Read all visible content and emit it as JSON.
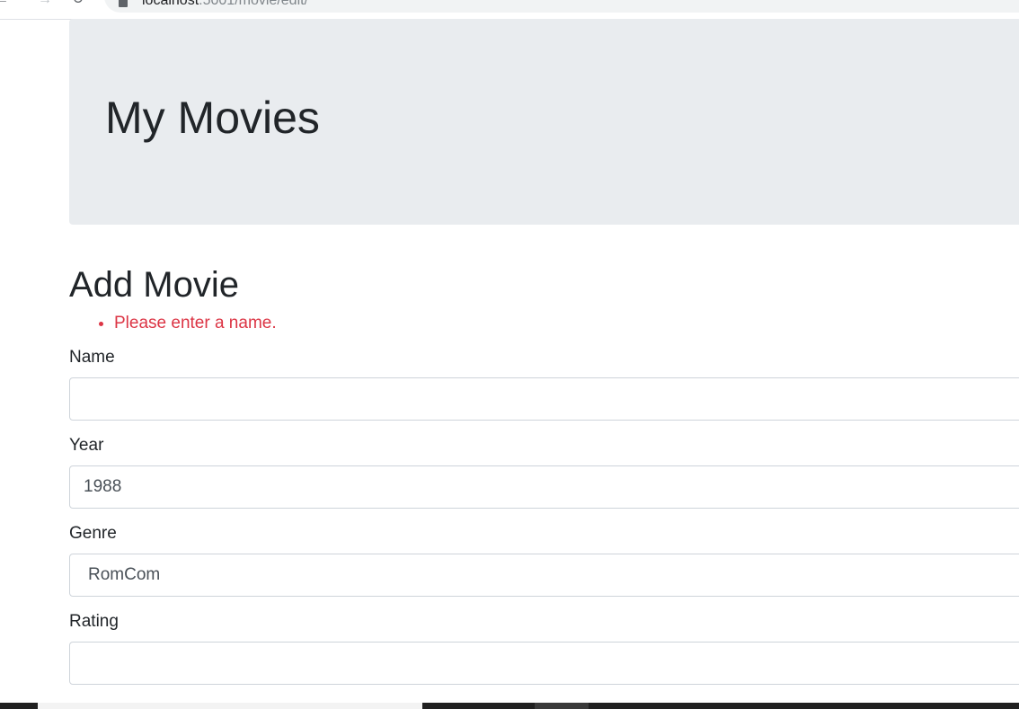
{
  "browser": {
    "url_host": "localhost",
    "url_path": ":5001/movie/edit/"
  },
  "header": {
    "title": "My Movies"
  },
  "form": {
    "heading": "Add Movie",
    "errors": [
      "Please enter a name."
    ],
    "fields": {
      "name": {
        "label": "Name",
        "value": ""
      },
      "year": {
        "label": "Year",
        "value": "1988"
      },
      "genre": {
        "label": "Genre",
        "value": "RomCom"
      },
      "rating": {
        "label": "Rating",
        "value": ""
      }
    }
  },
  "colors": {
    "jumbotron_bg": "#e9ecef",
    "error_text": "#dc3545",
    "input_border": "#ced4da"
  }
}
